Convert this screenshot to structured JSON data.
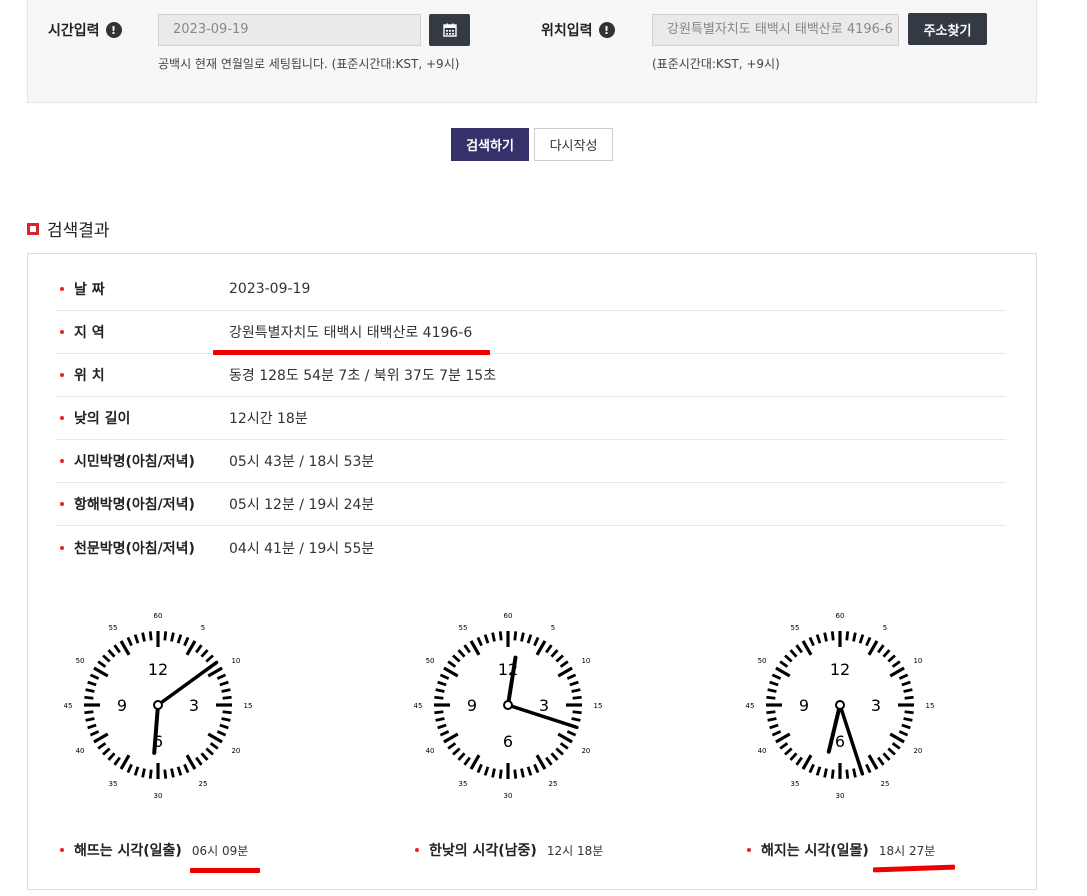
{
  "search_form": {
    "time_label": "시간입력",
    "time_value": "2023-09-19",
    "time_hint": "공백시 현재 연월일로 세팅됩니다. (표준시간대:KST, +9시)",
    "location_label": "위치입력",
    "location_value": "강원특별자치도 태백시 태백산로 4196-6",
    "location_button": "주소찾기",
    "location_hint": "(표준시간대:KST, +9시)",
    "info_glyph": "!",
    "calendar_icon": "calendar-icon"
  },
  "actions": {
    "search_label": "검색하기",
    "reset_label": "다시작성"
  },
  "results": {
    "title": "검색결과",
    "rows": [
      {
        "label": "날 짜",
        "value": "2023-09-19"
      },
      {
        "label": "지 역",
        "value": "강원특별자치도 태백시 태백산로 4196-6"
      },
      {
        "label": "위 치",
        "value": "동경 128도 54분 7초 / 북위 37도 7분 15초"
      },
      {
        "label": "낮의 길이",
        "value": "12시간 18분"
      },
      {
        "label": "시민박명(아침/저녁)",
        "value": "05시 43분 / 18시 53분"
      },
      {
        "label": "항해박명(아침/저녁)",
        "value": "05시 12분 / 19시 24분"
      },
      {
        "label": "천문박명(아침/저녁)",
        "value": "04시 41분 / 19시 55분"
      }
    ],
    "clocks": [
      {
        "caption": "해뜨는 시각(일출)",
        "time": "06시 09분",
        "hour": 6,
        "minute": 9
      },
      {
        "caption": "한낮의 시각(남중)",
        "time": "12시 18분",
        "hour": 12,
        "minute": 18
      },
      {
        "caption": "해지는 시각(일몰)",
        "time": "18시 27분",
        "hour": 18,
        "minute": 27
      }
    ],
    "clock_hour_labels": [
      "12",
      "3",
      "6",
      "9"
    ],
    "clock_minute_labels": [
      "60",
      "5",
      "10",
      "15",
      "20",
      "25",
      "30",
      "35",
      "40",
      "45",
      "50",
      "55"
    ]
  },
  "colors": {
    "primary_button": "#36306b",
    "dark_button": "#333a44",
    "accent_red": "#ee0000",
    "bullet_red": "#e0262d"
  }
}
